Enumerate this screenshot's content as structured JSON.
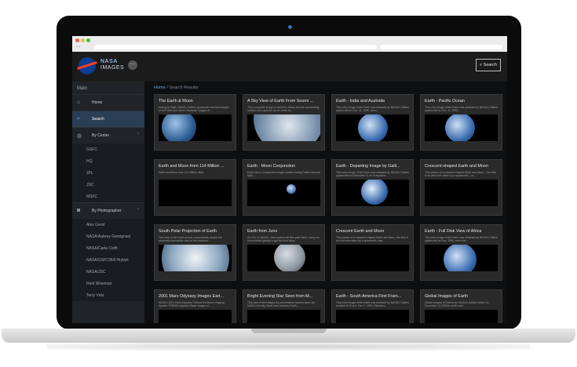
{
  "browser": {
    "nav": "‹ ›"
  },
  "header": {
    "brand_line1": "NASA",
    "brand_line2": "IMAGES",
    "menu_icon_glyph": "⋯",
    "search_label": "Search",
    "search_icon_glyph": "⌕"
  },
  "sidebar": {
    "heading": "Main",
    "home": {
      "label": "Home",
      "icon": "home-icon"
    },
    "search": {
      "label": "Search",
      "icon": "search-icon"
    },
    "by_center": {
      "label": "By Center",
      "icon": "globe-icon"
    },
    "centers": [
      "GSFC",
      "HQ",
      "JPL",
      "JSC",
      "MSFC"
    ],
    "by_photographer": {
      "label": "By Photographer",
      "icon": "camera-icon"
    },
    "photographers": [
      "Alex Gerst",
      "NASA/Aubrey Gemignani",
      "NASA/Carla Cioffi",
      "NASA/GSFC/Bill Hrybyk",
      "NASA/JSC",
      "Reid Wiseman",
      "Terry Virts"
    ]
  },
  "breadcrumb": {
    "home": "Home",
    "sep": "/",
    "current": "Search Results"
  },
  "results": [
    {
      "title": "The Earth & Moon",
      "desc": "During its flight, NASA's Galileo spacecraft returned images of the Earth and Moon. Separate images of..."
    },
    {
      "title": "A Sky View of Earth From Suomi ...",
      "desc": "This composite image of southern Africa and the surrounding oceans was captured by six orbits of..."
    },
    {
      "title": "Earth - India and Australia",
      "desc": "This color image of the Earth was obtained by NASA's Galileo spacecraft on Dec. 11, 1990, when..."
    },
    {
      "title": "Earth - Pacific Ocean",
      "desc": "This color image of the Earth was obtained by NASA's Galileo spacecraft on Dec. 11, 1990..."
    },
    {
      "title": "Earth and Moon from 114 Million ...",
      "desc": "Earth and Moon from 114 Million Miles"
    },
    {
      "title": "Earth - Moon Conjunction",
      "desc": "Earth-Moon Conjunction image created during Galileo second flyby..."
    },
    {
      "title": "Earth - Departing Image by Galil...",
      "desc": "This color image of the Earth was obtained by NASA's Galileo spacecraft on December 11 as it departed..."
    },
    {
      "title": "Crescent-shaped Earth and Moon",
      "desc": "This picture of a crescent-shaped Earth and Moon -- the first of its kind ever taken by a spacecraft -- w..."
    },
    {
      "title": "South Polar Projection of Earth",
      "desc": "This view of the Earth shows a wonderfully simple but physically impossible view of the southern..."
    },
    {
      "title": "Earth from Juno",
      "desc": "On Oct. 9, NASA's Juno spacecraft flew past Earth, using our home planet gravity to get the final boos..."
    },
    {
      "title": "Crescent Earth and Moon",
      "desc": "This picture of a crescent-shaped Earth and Moon, the first of its kind ever taken by a spacecraft, was..."
    },
    {
      "title": "Earth - Full Disk View of Africa",
      "desc": "This color image of the Earth was obtained by NASA's Galileo spacecraft on Dec. 1990, when the..."
    },
    {
      "title": "2001 Mars Odyssey Images Eart...",
      "desc": "NASA's 2001 Mars Odyssey Thermal Emission Imaging System THEMIS acquired these images of..."
    },
    {
      "title": "Bright Evening Star Seen from M...",
      "desc": "This view of the twilight sky and Martian horizon taken by NASA Curiosity Mars rover includes Earth..."
    },
    {
      "title": "Earth - South America First Fram...",
      "desc": "This color image of the Earth was obtained by NASA's Galileo at about 6:10 a.m. Dec 7, 1990, Standard..."
    },
    {
      "title": "Global Images of Earth",
      "desc": "Global images of Earth from NASA's Galileo orbiter on December 11 1990 in north color..."
    }
  ]
}
